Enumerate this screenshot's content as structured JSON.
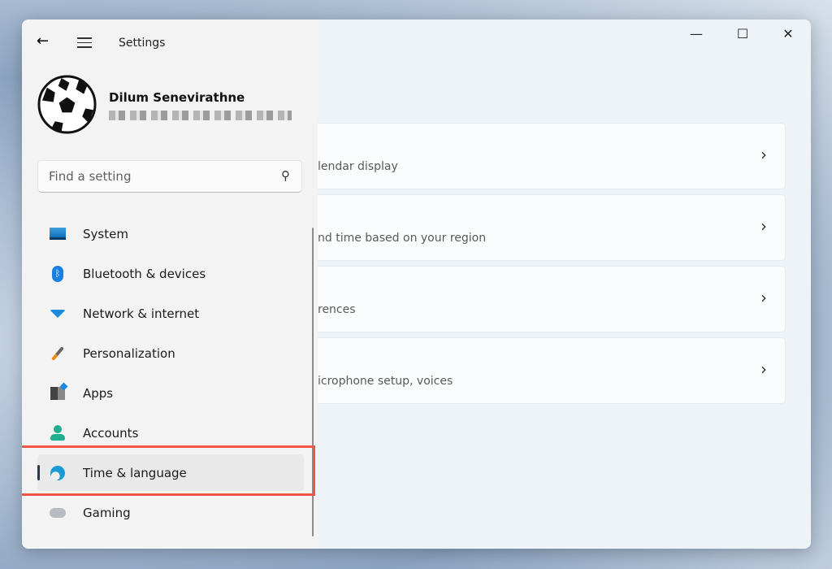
{
  "window": {
    "title": "Settings",
    "minimize": "—",
    "maximize": "☐",
    "close": "✕"
  },
  "user": {
    "name": "Dilum Senevirathne"
  },
  "search": {
    "placeholder": "Find a setting"
  },
  "nav": [
    {
      "label": "System",
      "icon": "monitor-icon"
    },
    {
      "label": "Bluetooth & devices",
      "icon": "bluetooth-icon"
    },
    {
      "label": "Network & internet",
      "icon": "wifi-icon"
    },
    {
      "label": "Personalization",
      "icon": "brush-icon"
    },
    {
      "label": "Apps",
      "icon": "apps-icon"
    },
    {
      "label": "Accounts",
      "icon": "person-icon"
    },
    {
      "label": "Time & language",
      "icon": "globe-clock-icon",
      "selected": true
    },
    {
      "label": "Gaming",
      "icon": "gamepad-icon"
    }
  ],
  "cards": [
    {
      "desc": "lendar display"
    },
    {
      "desc": "nd time based on your region"
    },
    {
      "desc": "rences"
    },
    {
      "desc": "icrophone setup, voices"
    }
  ],
  "colors": {
    "highlight": "#f0544a",
    "accent": "#0078d4"
  }
}
